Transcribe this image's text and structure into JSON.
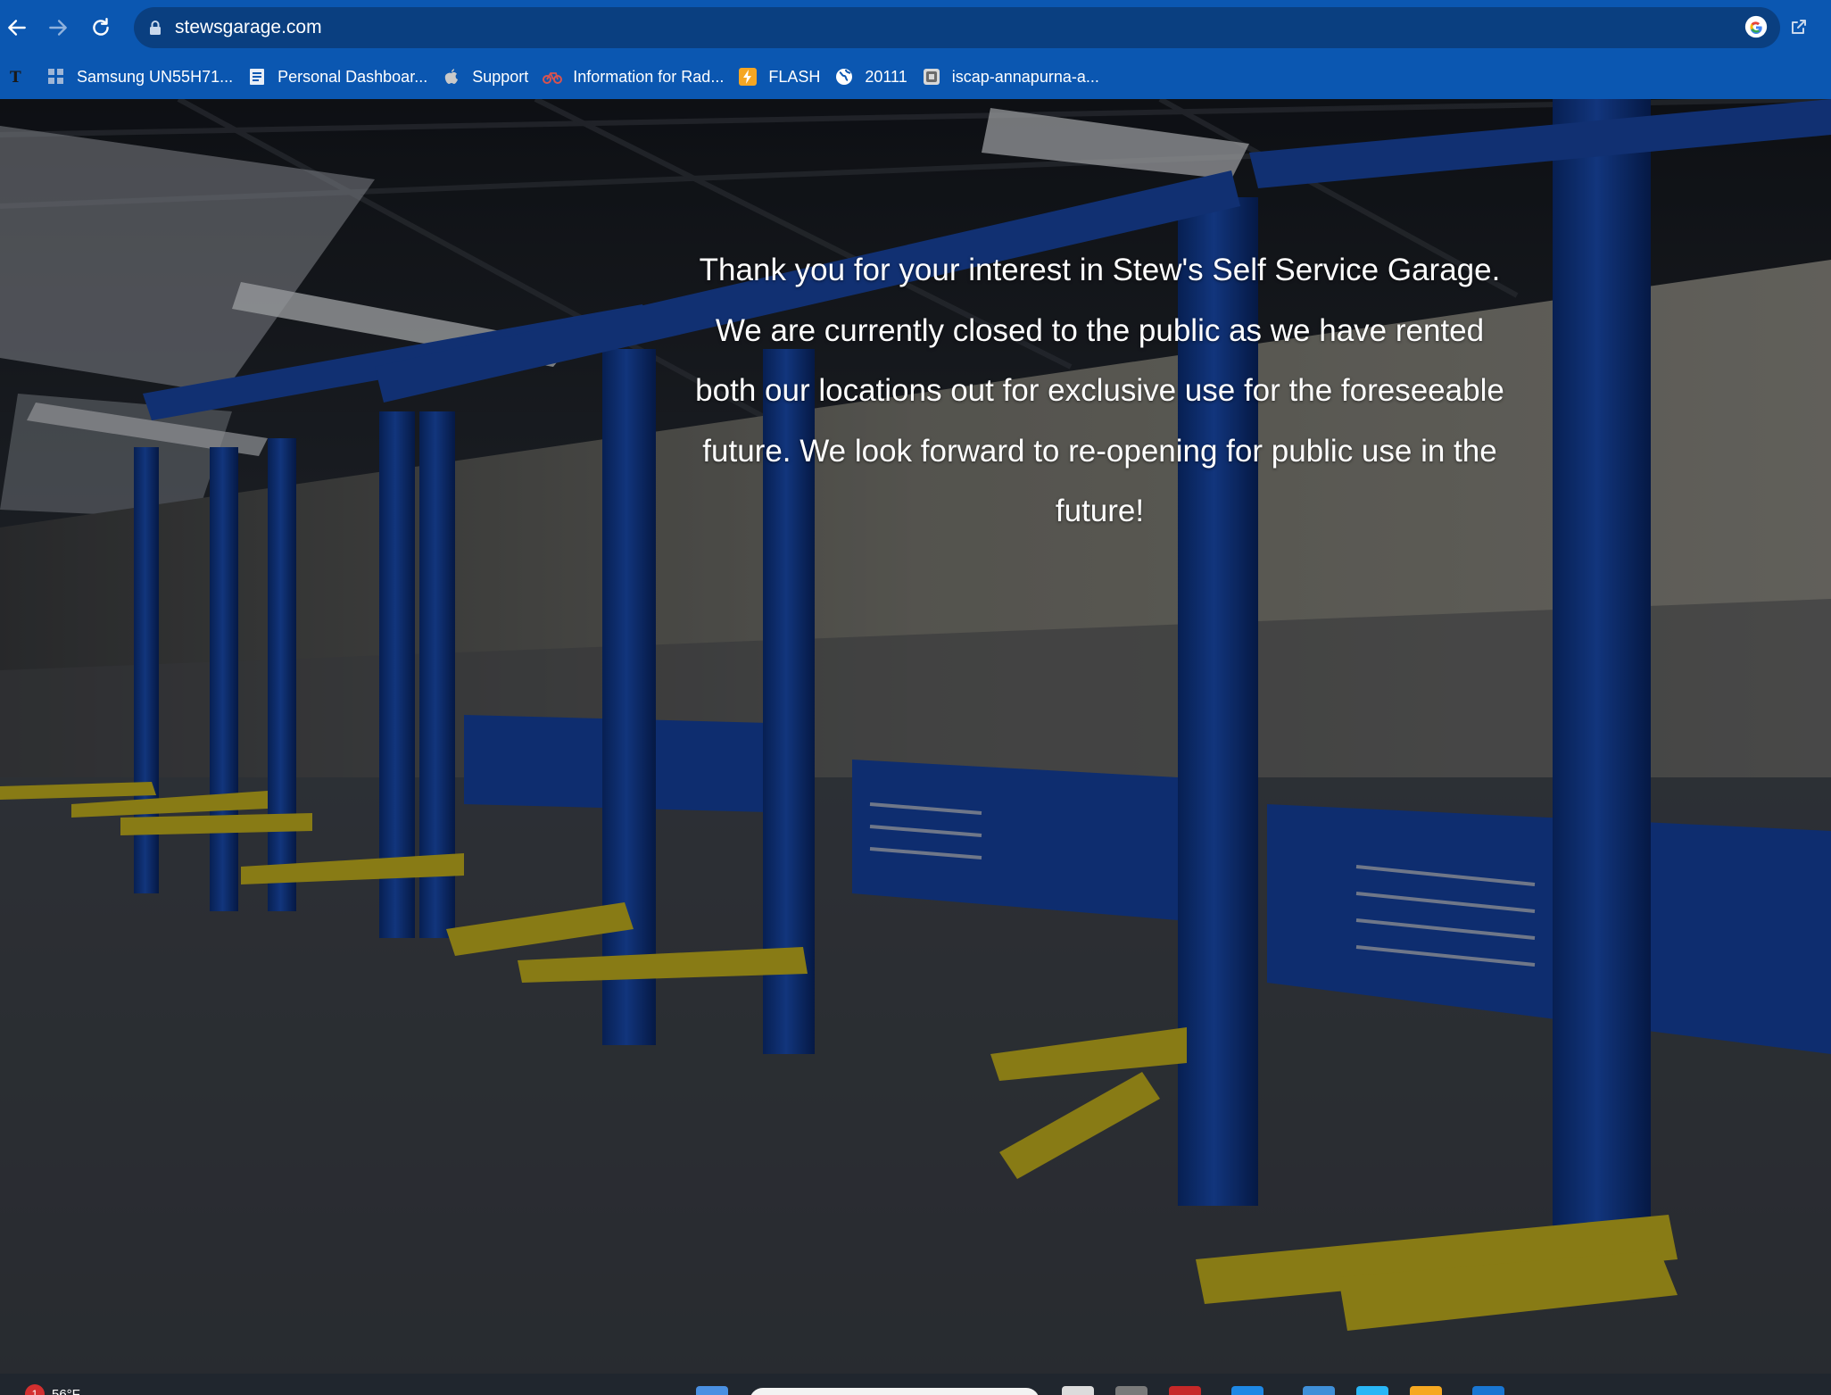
{
  "browser": {
    "url": "stewsgarage.com",
    "bookmarks": [
      {
        "label": "Samsung UN55H71...",
        "icon": "grid-doc-icon"
      },
      {
        "label": "Personal Dashboar...",
        "icon": "doc-icon"
      },
      {
        "label": "Support",
        "icon": "apple-icon"
      },
      {
        "label": "Information for Rad...",
        "icon": "bike-icon"
      },
      {
        "label": "FLASH",
        "icon": "flash-icon"
      },
      {
        "label": "20111",
        "icon": "globe-icon"
      },
      {
        "label": "iscap-annapurna-a...",
        "icon": "app-icon"
      }
    ],
    "colors": {
      "chrome": "#0b57b1",
      "omnibox": "#0a3f80"
    }
  },
  "page": {
    "message": "Thank you for your interest in Stew's Self Service Garage. We are currently closed to the public as we have rented both our locations out for exclusive use for the foreseeable future. We look forward to re-opening for public use in the future!"
  },
  "taskbar": {
    "weather_badge": "1",
    "temperature": "56°F"
  }
}
